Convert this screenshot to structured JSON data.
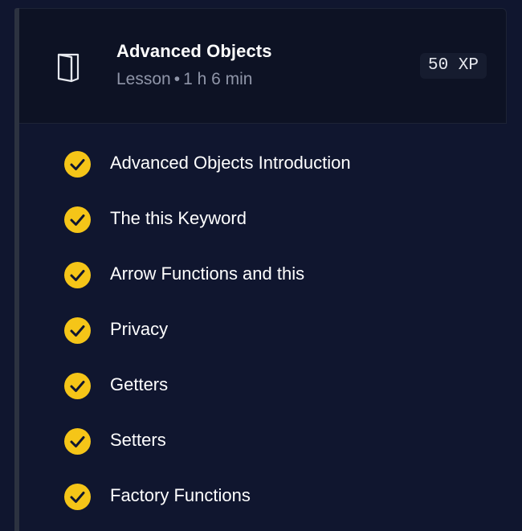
{
  "lesson": {
    "title": "Advanced Objects",
    "type": "Lesson",
    "separator": "•",
    "duration": "1 h 6 min",
    "xp": "50 XP",
    "icon": "book-icon"
  },
  "items": [
    {
      "label": "Advanced Objects Introduction",
      "status": "completed",
      "icon": "check-circle-icon"
    },
    {
      "label": "The this Keyword",
      "status": "completed",
      "icon": "check-circle-icon"
    },
    {
      "label": "Arrow Functions and this",
      "status": "completed",
      "icon": "check-circle-icon"
    },
    {
      "label": "Privacy",
      "status": "completed",
      "icon": "check-circle-icon"
    },
    {
      "label": "Getters",
      "status": "completed",
      "icon": "check-circle-icon"
    },
    {
      "label": "Setters",
      "status": "completed",
      "icon": "check-circle-icon"
    },
    {
      "label": "Factory Functions",
      "status": "completed",
      "icon": "check-circle-icon"
    }
  ],
  "colors": {
    "background": "#10162f",
    "check": "#f5c518",
    "text": "#ffffff",
    "muted": "#8f95a8"
  }
}
